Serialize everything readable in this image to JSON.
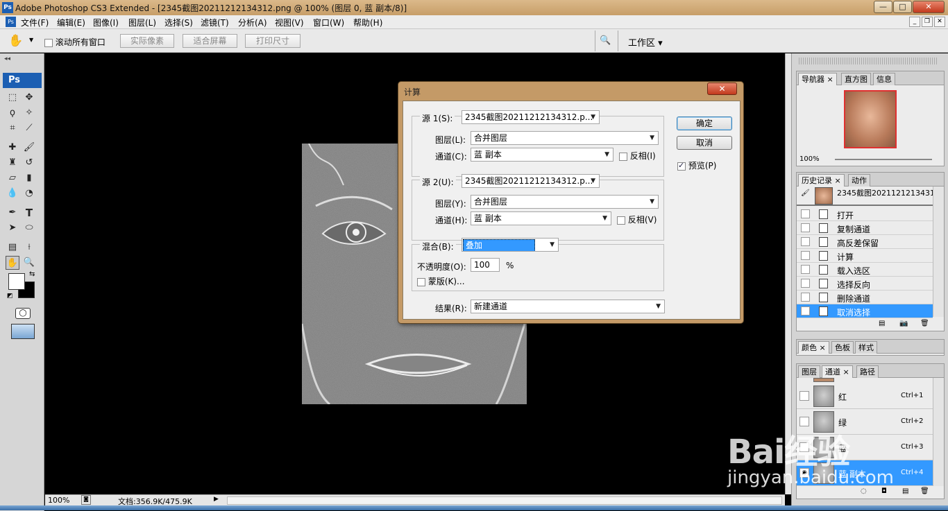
{
  "window": {
    "app_icon": "Ps",
    "title": "Adobe Photoshop CS3 Extended - [2345截图20211212134312.png @ 100% (图层 0, 蓝 副本/8)]",
    "controls": [
      "minimize-icon",
      "maximize-icon",
      "close-icon"
    ]
  },
  "menu": {
    "items": [
      "文件(F)",
      "编辑(E)",
      "图像(I)",
      "图层(L)",
      "选择(S)",
      "滤镜(T)",
      "分析(A)",
      "视图(V)",
      "窗口(W)",
      "帮助(H)"
    ]
  },
  "options": {
    "scroll_all_label": "滚动所有窗口",
    "scroll_all_checked": false,
    "actual_pixels": "实际像素",
    "fit_screen": "适合屏幕",
    "print_size": "打印尺寸",
    "workspace": "工作区"
  },
  "toolbox": {
    "logo": "Ps"
  },
  "status": {
    "zoom": "100%",
    "doc": "文档:356.9K/475.9K"
  },
  "navigator": {
    "tabs": [
      "导航器",
      "直方图",
      "信息"
    ],
    "zoom": "100%"
  },
  "history": {
    "tabs": [
      "历史记录",
      "动作"
    ],
    "snapshot": "2345截图2021121213431...",
    "items": [
      "打开",
      "复制通道",
      "高反差保留",
      "计算",
      "载入选区",
      "选择反向",
      "删除通道",
      "取消选择"
    ],
    "selected_index": 7
  },
  "color_panel": {
    "tabs": [
      "颜色",
      "色板",
      "样式"
    ]
  },
  "channels": {
    "tabs": [
      "图层",
      "通道",
      "路径"
    ],
    "rows": [
      {
        "name": "红",
        "shortcut": "Ctrl+1"
      },
      {
        "name": "绿",
        "shortcut": "Ctrl+2"
      },
      {
        "name": "蓝",
        "shortcut": "Ctrl+3"
      },
      {
        "name": "蓝 副本",
        "shortcut": "Ctrl+4"
      }
    ]
  },
  "dialog": {
    "title": "计算",
    "source1": {
      "label": "源 1(S):",
      "value": "2345截图20211212134312.p...",
      "layer_label": "图层(L):",
      "layer_value": "合并图层",
      "channel_label": "通道(C):",
      "channel_value": "蓝 副本",
      "invert_label": "反相(I)",
      "invert_checked": false
    },
    "source2": {
      "label": "源 2(U):",
      "value": "2345截图20211212134312.p...",
      "layer_label": "图层(Y):",
      "layer_value": "合并图层",
      "channel_label": "通道(H):",
      "channel_value": "蓝 副本",
      "invert_label": "反相(V)",
      "invert_checked": false
    },
    "blend": {
      "label": "混合(B):",
      "value": "叠加",
      "opacity_label": "不透明度(O):",
      "opacity_value": "100",
      "opacity_unit": "%",
      "mask_label": "蒙版(K)...",
      "mask_checked": false
    },
    "result": {
      "label": "结果(R):",
      "value": "新建通道"
    },
    "ok": "确定",
    "cancel": "取消",
    "preview_label": "预览(P)",
    "preview_checked": true
  },
  "watermark": {
    "logo": "Bai经验",
    "url": "jingyan.baidu.com"
  },
  "colors": {
    "selection": "#3399ff",
    "title_bar": "#c79e68",
    "arrow": "#e02020"
  }
}
